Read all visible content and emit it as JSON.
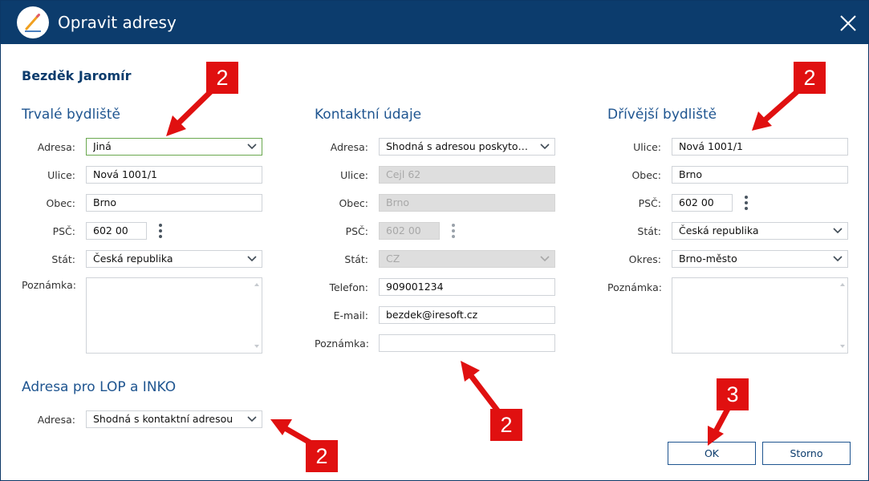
{
  "window": {
    "title": "Opravit adresy",
    "icon": "pencil-icon",
    "close_icon": "close-icon"
  },
  "person_name": "Bezděk Jaromír",
  "permanent": {
    "heading": "Trvalé bydliště",
    "address_label": "Adresa:",
    "address_value": "Jiná",
    "street_label": "Ulice:",
    "street_value": "Nová 1001/1",
    "city_label": "Obec:",
    "city_value": "Brno",
    "zip_label": "PSČ:",
    "zip_value": "602 00",
    "country_label": "Stát:",
    "country_value": "Česká republika",
    "note_label": "Poznámka:",
    "note_value": ""
  },
  "contact": {
    "heading": "Kontaktní údaje",
    "address_label": "Adresa:",
    "address_value": "Shodná s adresou poskytov...",
    "street_label": "Ulice:",
    "street_value": "Cejl 62",
    "city_label": "Obec:",
    "city_value": "Brno",
    "zip_label": "PSČ:",
    "zip_value": "602 00",
    "country_label": "Stát:",
    "country_value": "CZ",
    "phone_label": "Telefon:",
    "phone_value": "909001234",
    "email_label": "E-mail:",
    "email_value": "bezdek@iresoft.cz",
    "note_label": "Poznámka:",
    "note_value": ""
  },
  "previous": {
    "heading": "Dřívější bydliště",
    "street_label": "Ulice:",
    "street_value": "Nová 1001/1",
    "city_label": "Obec:",
    "city_value": "Brno",
    "zip_label": "PSČ:",
    "zip_value": "602 00",
    "country_label": "Stát:",
    "country_value": "Česká republika",
    "district_label": "Okres:",
    "district_value": "Brno-město",
    "note_label": "Poznámka:",
    "note_value": ""
  },
  "lop": {
    "heading": "Adresa pro LOP a INKO",
    "address_label": "Adresa:",
    "address_value": "Shodná s kontaktní adresou"
  },
  "buttons": {
    "ok": "OK",
    "cancel": "Storno"
  },
  "annotations": {
    "badge_permanent": "2",
    "badge_previous": "2",
    "badge_contact": "2",
    "badge_lop": "2",
    "badge_ok": "3",
    "color": "#e01010"
  },
  "colors": {
    "titlebar": "#0c3c6d",
    "heading": "#1f5590",
    "focus_border": "#6aa84f"
  }
}
